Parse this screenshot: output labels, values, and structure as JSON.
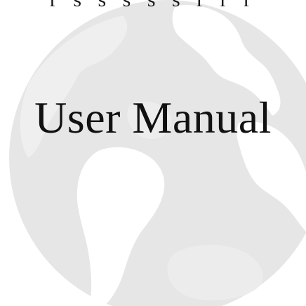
{
  "document": {
    "top_fragment": "r  s  s  s  s  s  r  r  r",
    "title": "User Manual"
  },
  "colors": {
    "globe_fill": "#e6e6e6",
    "globe_land": "#ffffff",
    "text": "#111111"
  }
}
